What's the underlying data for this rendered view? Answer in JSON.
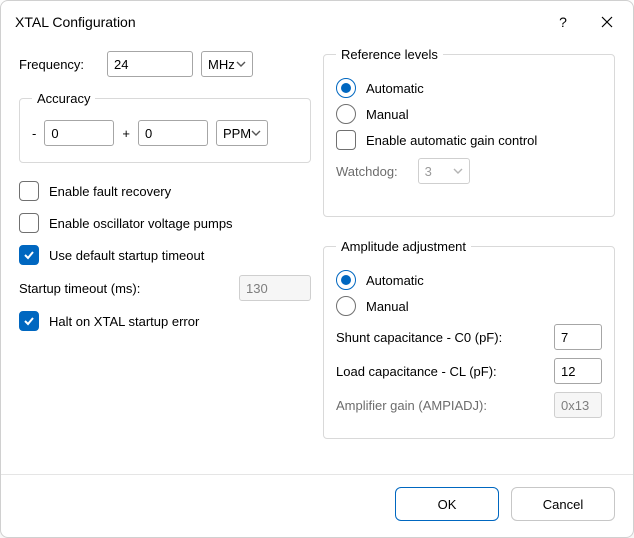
{
  "window": {
    "title": "XTAL Configuration",
    "help_icon": "?",
    "close_icon": "✕"
  },
  "left": {
    "frequency_label": "Frequency:",
    "frequency_value": "24",
    "frequency_unit": "MHz",
    "accuracy_legend": "Accuracy",
    "accuracy_minus": "-",
    "accuracy_low": "0",
    "accuracy_plus": "+",
    "accuracy_high": "0",
    "accuracy_unit": "PPM",
    "fault_recovery_label": "Enable fault recovery",
    "voltage_pumps_label": "Enable oscillator voltage pumps",
    "default_timeout_label": "Use default startup timeout",
    "startup_timeout_label": "Startup timeout (ms):",
    "startup_timeout_value": "130",
    "halt_label": "Halt on XTAL startup error"
  },
  "ref": {
    "legend": "Reference levels",
    "automatic": "Automatic",
    "manual": "Manual",
    "gain_label": "Enable automatic gain control",
    "watchdog_label": "Watchdog:",
    "watchdog_value": "3"
  },
  "amp": {
    "legend": "Amplitude adjustment",
    "automatic": "Automatic",
    "manual": "Manual",
    "shunt_label": "Shunt capacitance - C0 (pF):",
    "shunt_value": "7",
    "load_label": "Load capacitance - CL (pF):",
    "load_value": "12",
    "gain_label": "Amplifier gain (AMPIADJ):",
    "gain_value": "0x13"
  },
  "buttons": {
    "ok": "OK",
    "cancel": "Cancel"
  },
  "checks": {
    "fault_recovery": false,
    "voltage_pumps": false,
    "default_timeout": true,
    "halt": true,
    "auto_gain": false
  },
  "radios": {
    "reference_automatic": true,
    "amplitude_automatic": true
  }
}
